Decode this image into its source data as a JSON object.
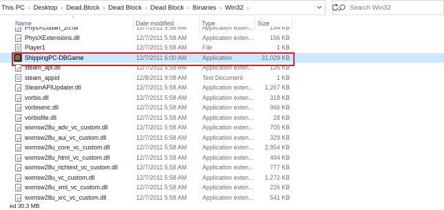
{
  "address": {
    "crumbs": [
      "This PC",
      "Desktop",
      "Dead.Block",
      "Dead Block",
      "Dead Block",
      "Binaries",
      "Win32"
    ]
  },
  "search": {
    "placeholder": "Search Win32"
  },
  "columns": {
    "name": "Name",
    "date": "Date modified",
    "type": "Type",
    "size": "Size"
  },
  "files": [
    {
      "name": "PhysXCudart_20.dll",
      "date": "12/7/2011 5:58 AM",
      "type": "Application exten...",
      "size": "194 KB",
      "icon": "dll-icon"
    },
    {
      "name": "PhysXExtensions.dll",
      "date": "12/7/2011 5:58 AM",
      "type": "Application exten...",
      "size": "156 KB",
      "icon": "dll-icon"
    },
    {
      "name": "Player1",
      "date": "12/7/2011 5:58 AM",
      "type": "File",
      "size": "1 KB",
      "icon": "file-icon"
    },
    {
      "name": "ShippingPC-DBGame",
      "date": "12/7/2011 6:00 AM",
      "type": "Application",
      "size": "31,029 KB",
      "icon": "app-icon",
      "selected": true
    },
    {
      "name": "steam_api.dll",
      "date": "12/7/2011 5:58 AM",
      "type": "Application exten...",
      "size": "126 KB",
      "icon": "dll-icon"
    },
    {
      "name": "steam_appid",
      "date": "12/8/2011 9:08 AM",
      "type": "Text Document",
      "size": "1 KB",
      "icon": "text-file-icon"
    },
    {
      "name": "SteamAPIUpdater.dll",
      "date": "12/7/2011 5:58 AM",
      "type": "Application exten...",
      "size": "1,267 KB",
      "icon": "dll-icon"
    },
    {
      "name": "vorbis.dll",
      "date": "12/7/2011 5:58 AM",
      "type": "Application exten...",
      "size": "318 KB",
      "icon": "dll-icon"
    },
    {
      "name": "vorbisenc.dll",
      "date": "12/7/2011 5:58 AM",
      "type": "Application exten...",
      "size": "966 KB",
      "icon": "dll-icon"
    },
    {
      "name": "vorbisfile.dll",
      "date": "12/7/2011 5:58 AM",
      "type": "Application exten...",
      "size": "28 KB",
      "icon": "dll-icon"
    },
    {
      "name": "wxmsw28u_adv_vc_custom.dll",
      "date": "12/7/2011 5:58 AM",
      "type": "Application exten...",
      "size": "705 KB",
      "icon": "dll-icon"
    },
    {
      "name": "wxmsw28u_aui_vc_custom.dll",
      "date": "12/7/2011 5:58 AM",
      "type": "Application exten...",
      "size": "329 KB",
      "icon": "dll-icon"
    },
    {
      "name": "wxmsw28u_core_vc_custom.dll",
      "date": "12/7/2011 5:58 AM",
      "type": "Application exten...",
      "size": "2,954 KB",
      "icon": "dll-icon"
    },
    {
      "name": "wxmsw28u_html_vc_custom.dll",
      "date": "12/7/2011 5:58 AM",
      "type": "Application exten...",
      "size": "494 KB",
      "icon": "dll-icon"
    },
    {
      "name": "wxmsw28u_richtext_vc_custom.dll",
      "date": "12/7/2011 5:58 AM",
      "type": "Application exten...",
      "size": "777 KB",
      "icon": "dll-icon"
    },
    {
      "name": "wxmsw28u_vc_custom.dll",
      "date": "12/7/2011 5:58 AM",
      "type": "Application exten...",
      "size": "1,272 KB",
      "icon": "dll-icon"
    },
    {
      "name": "wxmsw28u_xml_vc_custom.dll",
      "date": "12/7/2011 5:58 AM",
      "type": "Application exten...",
      "size": "226 KB",
      "icon": "dll-icon"
    },
    {
      "name": "wxmsw28u_xrc_vc_custom.dll",
      "date": "12/7/2011 5:58 AM",
      "type": "Application exten...",
      "size": "541 KB",
      "icon": "dll-icon"
    }
  ],
  "status": {
    "selection": "ed  30.3 MB"
  }
}
